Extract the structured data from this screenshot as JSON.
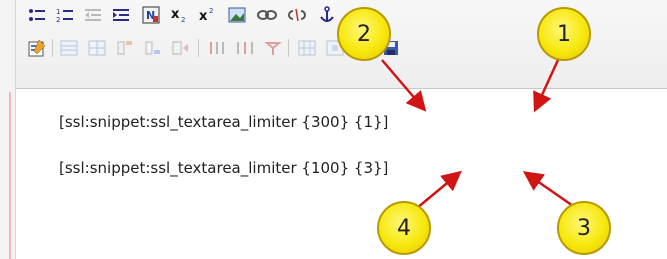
{
  "editor": {
    "toolbar": {
      "row1": [
        "bulleted-list-icon",
        "numbered-list-icon",
        "outdent-icon",
        "indent-icon",
        "paste-word-icon",
        "subscript-icon",
        "superscript-icon",
        "image-icon",
        "link-icon",
        "unlink-icon",
        "anchor-icon"
      ],
      "row2": [
        "edit-icon",
        "table-icon",
        "table-props-icon",
        "insert-row-icon",
        "delete-row-icon",
        "insert-col-icon",
        "merge-icon",
        "split-icon",
        "table-grid-icon",
        "table-cell-icon",
        "source-icon",
        "save-icon"
      ]
    },
    "lines": [
      {
        "text": "[ssl:snippet:ssl_textarea_limiter {300} {1}]"
      },
      {
        "text": "[ssl:snippet:ssl_textarea_limiter {100} {3}]"
      }
    ]
  },
  "callouts": [
    {
      "number": "1"
    },
    {
      "number": "2"
    },
    {
      "number": "3"
    },
    {
      "number": "4"
    }
  ],
  "colors": {
    "callout_fill": "#f7e80d",
    "arrow": "#d11414",
    "toolbar_icon": "#2a2a8a"
  }
}
